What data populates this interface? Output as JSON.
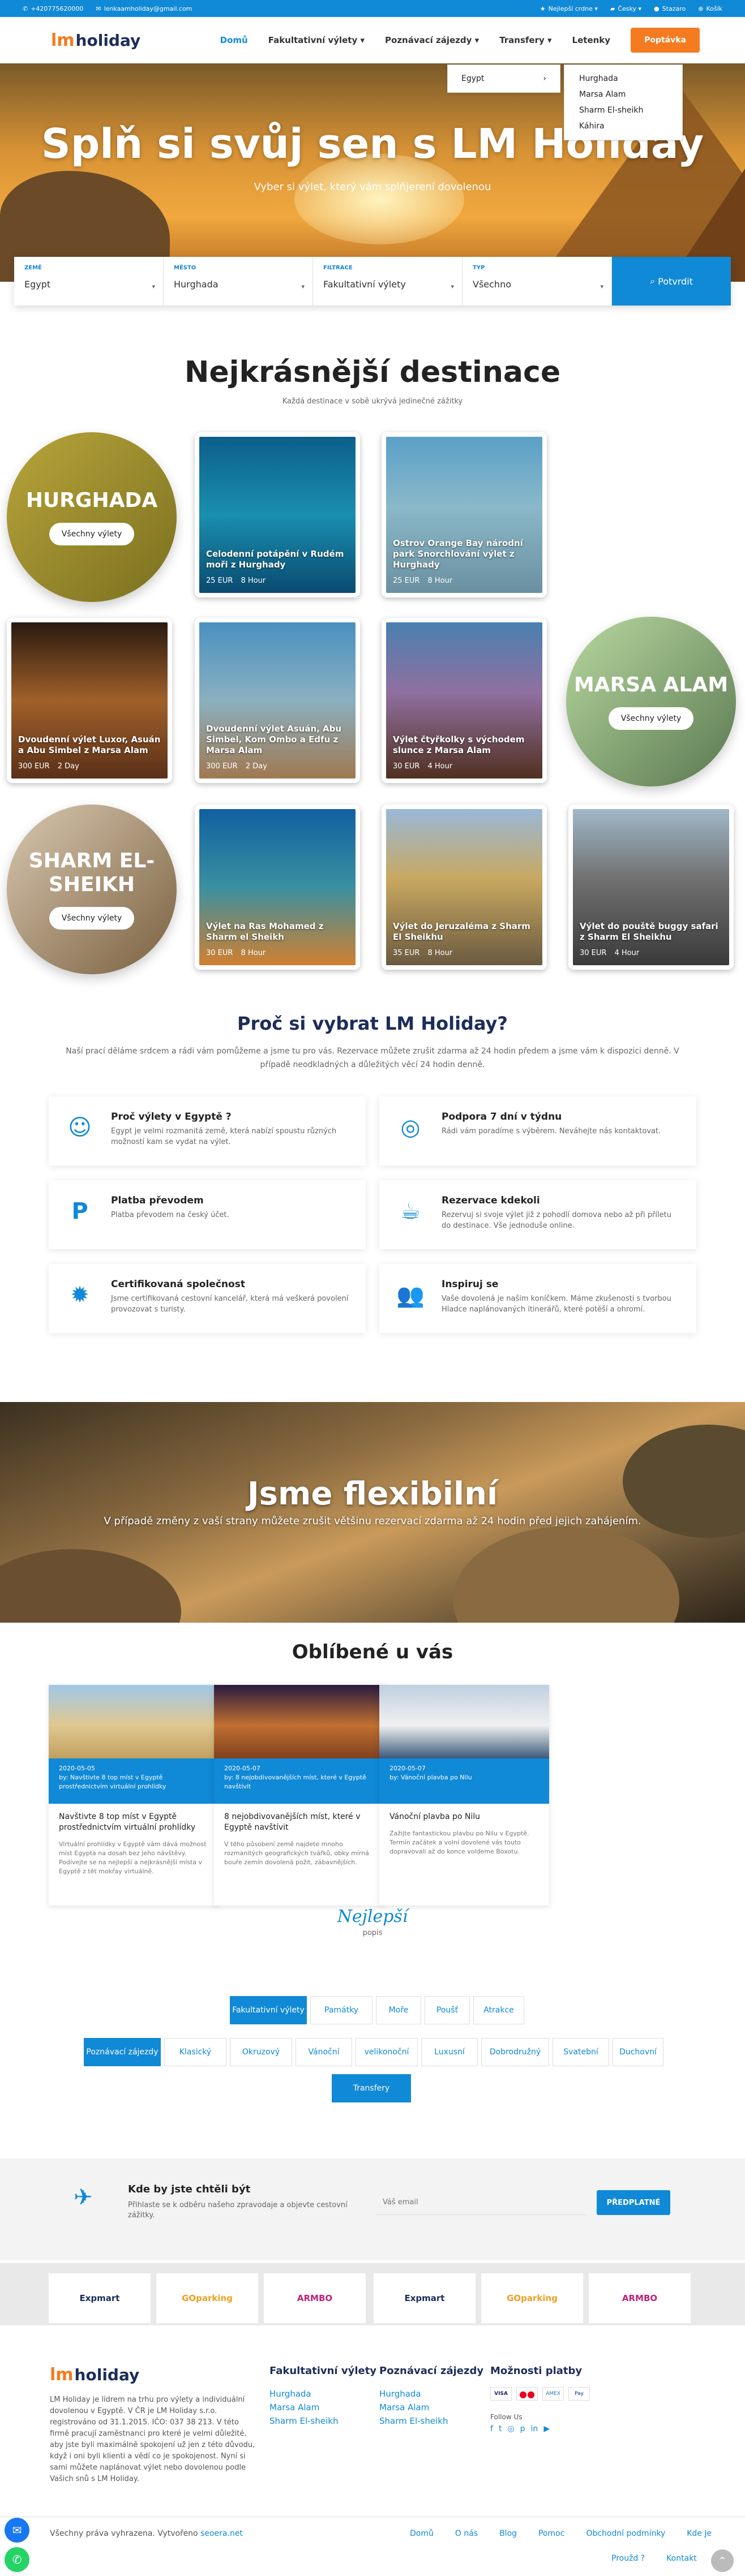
{
  "topbar": {
    "phone": "+420775620000",
    "email": "lenkaamholiday@gmail.com",
    "reviews": "Nejlepší crdne",
    "lang": "Česky",
    "login": "Stazaro",
    "cart": "Košík"
  },
  "nav": {
    "logo_lm": "lm",
    "logo_text": "holiday",
    "items": [
      "Domů",
      "Fakultativní výlety",
      "Poznávací zájezdy",
      "Transfery",
      "Letenky"
    ],
    "cta": "Poptávka"
  },
  "dropdown": {
    "country": "Egypt",
    "cities": [
      "Hurghada",
      "Marsa Alam",
      "Sharm El-sheikh",
      "Káhira"
    ]
  },
  "hero": {
    "title": "Splň si svůj sen s LM Holiday",
    "subtitle": "Vyber si výlet, který vám splňjerení dovolenou"
  },
  "search": {
    "fields": [
      {
        "label": "ZEMĚ",
        "value": "Egypt"
      },
      {
        "label": "MĚSTO",
        "value": "Hurghada"
      },
      {
        "label": "FILTRACE",
        "value": "Fakultativní výlety"
      },
      {
        "label": "TYP",
        "value": "Všechno"
      }
    ],
    "button": "Potvrdit"
  },
  "destinations": {
    "title": "Nejkrásnější destinace",
    "subtitle": "Každá destinace v sobě ukrývá jedinečné zážitky",
    "more": "Všechny výlety",
    "regions": [
      "HURGHADA",
      "MARSA ALAM",
      "SHARM EL-SHEIKH"
    ],
    "trips": [
      {
        "title": "Celodenní potápění v Rudém moři z Hurghady",
        "price": "25 EUR",
        "dur": "8 Hour"
      },
      {
        "title": "Ostrov Orange Bay národní park Snorchlování výlet z Hurghady",
        "price": "25 EUR",
        "dur": "8 Hour"
      },
      {
        "title": "Dvoudenní výlet Luxor, Asuán a Abu Simbel z Marsa Alam",
        "price": "300 EUR",
        "dur": "2 Day"
      },
      {
        "title": "Dvoudenní výlet Asuán, Abu Simbel, Kom Ombo a Edfu z Marsa Alam",
        "price": "300 EUR",
        "dur": "2 Day"
      },
      {
        "title": "Výlet čtyřkolky s východem slunce z Marsa Alam",
        "price": "30 EUR",
        "dur": "4 Hour"
      },
      {
        "title": "Výlet na Ras Mohamed z Sharm el Sheikh",
        "price": "30 EUR",
        "dur": "8 Hour"
      },
      {
        "title": "Výlet do Jeruzaléma z Sharm El Sheikhu",
        "price": "35 EUR",
        "dur": "8 Hour"
      },
      {
        "title": "Výlet do pouště buggy safari z Sharm El Sheikhu",
        "price": "30 EUR",
        "dur": "4 Hour"
      }
    ]
  },
  "why": {
    "title": "Proč si vybrat LM Holiday?",
    "text": "Naší prací děláme srdcem a rádi vám pomůžeme a jsme tu pro vás. Rezervace můžete zrušit zdarma až 24 hodin předem a jsme vám k dispozici denně. V případě neodkladných a důležitých věcí 24 hodin denně.",
    "features": [
      {
        "title": "Proč výlety v Egyptě ?",
        "text": "Egypt je velmi rozmanitá země, která nabízí spoustu různých možností kam se vydat na výlet."
      },
      {
        "title": "Podpora 7 dní v týdnu",
        "text": "Rádi vám poradíme s výběrem. Neváhejte nás kontaktovat."
      },
      {
        "title": "Platba převodem",
        "text": "Platba převodem na český účet."
      },
      {
        "title": "Rezervace kdekoli",
        "text": "Rezervuj si svoje výlet již z pohodlí domova nebo až při příletu do destinace. Vše jednoduše online."
      },
      {
        "title": "Certifikovaná společnost",
        "text": "Jsme certifikovaná cestovní kancelář, která má veškerá povolení provozovat s turisty."
      },
      {
        "title": "Inspiruj se",
        "text": "Vaše dovolená je našim koníčkem. Máme zkušenosti s tvorbou Hladce naplánovaných itinerářů, které potěší a ohromí."
      }
    ]
  },
  "flex": {
    "title": "Jsme flexibilní",
    "text": "V případě změny z vaší strany můžete zrušit většinu rezervací zdarma až 24 hodin před jejich zahájením."
  },
  "popular": {
    "title": "Oblíbené u vás",
    "posts": [
      {
        "date": "2020-05-05",
        "bar": "by: Navštivte 8 top míst v Egyptě prostřednictvím virtuální prohlídky",
        "title": "Navštivte 8 top míst v Egyptě prostřednictvím virtuální prohlídky",
        "text": "Virtuální prohlídky v Egyptě vám dává možnost míst Egypta na dosah bez jeho návštěvy. Podívejte se na nejlepší a nejkrásnější místa v Egyptě z tět mokřay virtuálně."
      },
      {
        "date": "2020-05-07",
        "bar": "by: 8 nejobdivovanějších míst, které v Egyptě navštívit",
        "title": "8 nejobdivovanějších míst, které v Egyptě navštívit",
        "text": "V tého působení země najdete mnoho rozmanitých geografických tvářků, obky mírná bouře zemín dovolená požit, zábavnějších."
      },
      {
        "date": "2020-05-07",
        "bar": "by: Vánoční plavba po Nilu",
        "title": "Vánoční plavba po Nilu",
        "text": "Zažijte fantastickou plavbu po Nilu v Egyptě. Termín začátek a volní dovolené vás touto dopravovali až do konce voldeme Boxotu."
      }
    ]
  },
  "best": {
    "script": "Nejlepší",
    "sub": "popis",
    "row1": [
      "Fakultativní výlety",
      "Památky",
      "Moře",
      "Poušť",
      "Atrakce"
    ],
    "row2": [
      "Poznávací zájezdy",
      "Klasický",
      "Okruzový",
      "Vánoční",
      "velikonoční",
      "Luxusní",
      "Dobrodružný",
      "Svatební",
      "Duchovní"
    ],
    "row3": [
      "Transfery"
    ]
  },
  "newsletter": {
    "title": "Kde by jste chtěli být",
    "text": "Přihlaste se k odběru našeho zpravodaje a objevte cestovní zážitky.",
    "placeholder": "Váš email",
    "button": "PŘEDPLATNÉ"
  },
  "partners": [
    "Expmart",
    "GOparking",
    "ARMBO",
    "Expmart",
    "GOparking",
    "ARMBO"
  ],
  "footer": {
    "about": "LM Holiday je lídrem na trhu pro výlety a individuální dovolenou v Egyptě. V ČR je LM Holiday s.r.o. registrováno od 31.1.2015. IČO: 037 38 213. V této firmě pracují zaměstnanci pro které je velmi důležité, aby jste byli maximálně spokojení už jen z této důvodu, když i oni byli klienti a vědí co je spokojenost. Nyní si sami můžete naplánovat výlet nebo dovolenou podle Vašich snů s LM Holiday.",
    "col1_title": "Fakultativní výlety",
    "col1": [
      "Hurghada",
      "Marsa Alam",
      "Sharm El-sheikh"
    ],
    "col2_title": "Poznávací zájezdy",
    "col2": [
      "Hurghada",
      "Marsa Alam",
      "Sharm El-sheikh"
    ],
    "col3_title": "Možnosti platby",
    "follow": "Follow Us",
    "copyright": "Všechny práva vyhrazena.  Vytvořeno",
    "creator": "seoera.net",
    "links": [
      "Domů",
      "O nás",
      "Blog",
      "Pomoc",
      "Obchodní podmínky",
      "Kde Je",
      "Proužd ?",
      "Kontakt"
    ]
  },
  "colors": {
    "primary": "#1089d6",
    "accent": "#f47b20",
    "navy": "#1c2d5a"
  }
}
